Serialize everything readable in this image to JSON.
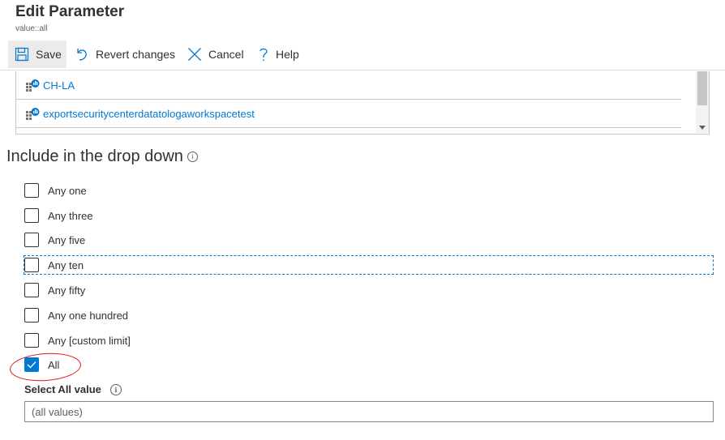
{
  "header": {
    "title": "Edit Parameter",
    "subtitle": "value::all"
  },
  "toolbar": {
    "save_label": "Save",
    "revert_label": "Revert changes",
    "cancel_label": "Cancel",
    "help_label": "Help"
  },
  "workspace_list": {
    "items": [
      {
        "label": "CH-LA",
        "icon": "log-analytics-workspace-icon"
      },
      {
        "label": "exportsecuritycenterdatatologaworkspacetest",
        "icon": "log-analytics-workspace-icon"
      },
      {
        "label": "",
        "icon": "log-analytics-workspace-icon"
      }
    ]
  },
  "dropdown_section": {
    "title": "Include in the drop down",
    "info_icon": "info-icon",
    "options": [
      {
        "label": "Any one",
        "checked": false
      },
      {
        "label": "Any three",
        "checked": false
      },
      {
        "label": "Any five",
        "checked": false
      },
      {
        "label": "Any ten",
        "checked": false
      },
      {
        "label": "Any fifty",
        "checked": false
      },
      {
        "label": "Any one hundred",
        "checked": false
      },
      {
        "label": "Any [custom limit]",
        "checked": false
      },
      {
        "label": "All",
        "checked": true
      }
    ]
  },
  "select_all": {
    "label": "Select All value",
    "value": "(all values)"
  },
  "colors": {
    "accent": "#0078d4",
    "annotation": "#e0191b"
  }
}
